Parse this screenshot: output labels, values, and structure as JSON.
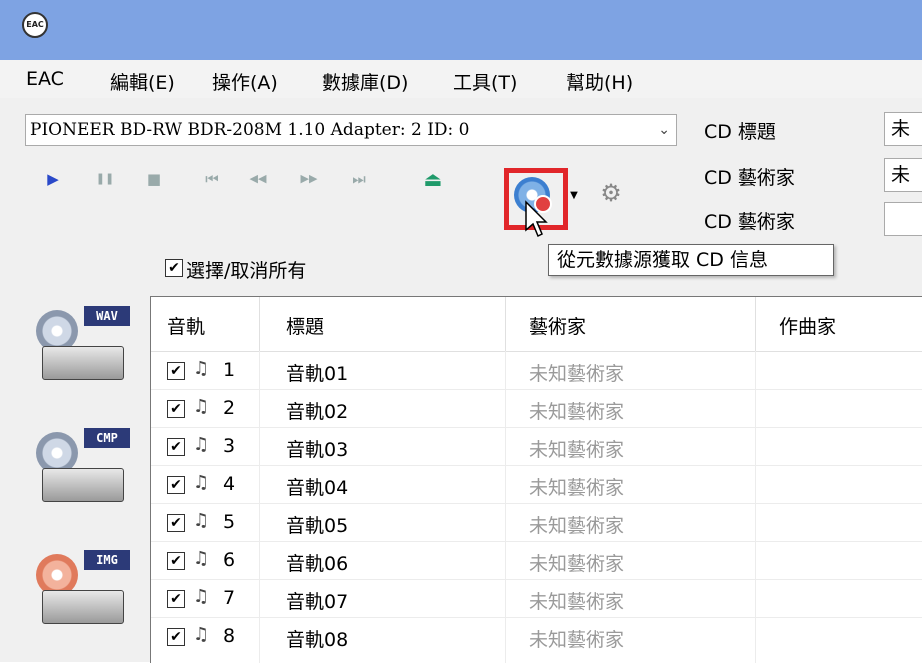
{
  "app_icon_label": "EAC",
  "menu": [
    "EAC",
    "編輯(E)",
    "操作(A)",
    "數據庫(D)",
    "工具(T)",
    "幫助(H)"
  ],
  "drive_select": {
    "value": "PIONEER BD-RW   BDR-208M 1.10  Adapter: 2  ID: 0",
    "chevron": "⌄"
  },
  "cd_fields": [
    {
      "label": "CD 標題",
      "value": "未"
    },
    {
      "label": "CD 藝術家",
      "value": "未"
    },
    {
      "label": "CD 藝術家",
      "value": ""
    }
  ],
  "toolbar_icons": [
    "play-icon",
    "pause-icon",
    "stop-icon",
    "prev-track-icon",
    "rewind-icon",
    "fast-forward-icon",
    "next-track-icon",
    "eject-icon",
    "get-cd-info-icon",
    "dropdown-arrow-icon",
    "network-icon"
  ],
  "toolbar_glyphs": {
    "play": "▶",
    "pause": "❚❚",
    "stop": "■",
    "prev": "⏮",
    "rew": "◀◀",
    "ff": "▶▶",
    "next": "⏭",
    "eject": "⏏",
    "drop": "▼",
    "net": "⚙"
  },
  "tooltip": "從元數據源獲取 CD 信息",
  "select_all": {
    "checked": true,
    "label": "選擇/取消所有"
  },
  "side_badges": [
    "WAV",
    "CMP",
    "IMG"
  ],
  "columns": [
    "音軌",
    "標題",
    "藝術家",
    "作曲家"
  ],
  "tracks": [
    {
      "num": "1",
      "title": "音軌01",
      "artist": "未知藝術家",
      "checked": true
    },
    {
      "num": "2",
      "title": "音軌02",
      "artist": "未知藝術家",
      "checked": true
    },
    {
      "num": "3",
      "title": "音軌03",
      "artist": "未知藝術家",
      "checked": true
    },
    {
      "num": "4",
      "title": "音軌04",
      "artist": "未知藝術家",
      "checked": true
    },
    {
      "num": "5",
      "title": "音軌05",
      "artist": "未知藝術家",
      "checked": true
    },
    {
      "num": "6",
      "title": "音軌06",
      "artist": "未知藝術家",
      "checked": true
    },
    {
      "num": "7",
      "title": "音軌07",
      "artist": "未知藝術家",
      "checked": true
    },
    {
      "num": "8",
      "title": "音軌08",
      "artist": "未知藝術家",
      "checked": true
    }
  ],
  "check_glyph": "✔",
  "note_glyph": "♫",
  "colors": {
    "titlebar": "#7ea3e3",
    "highlight": "#e1262a",
    "play": "#2a49c9",
    "eject": "#1f9a6a"
  }
}
